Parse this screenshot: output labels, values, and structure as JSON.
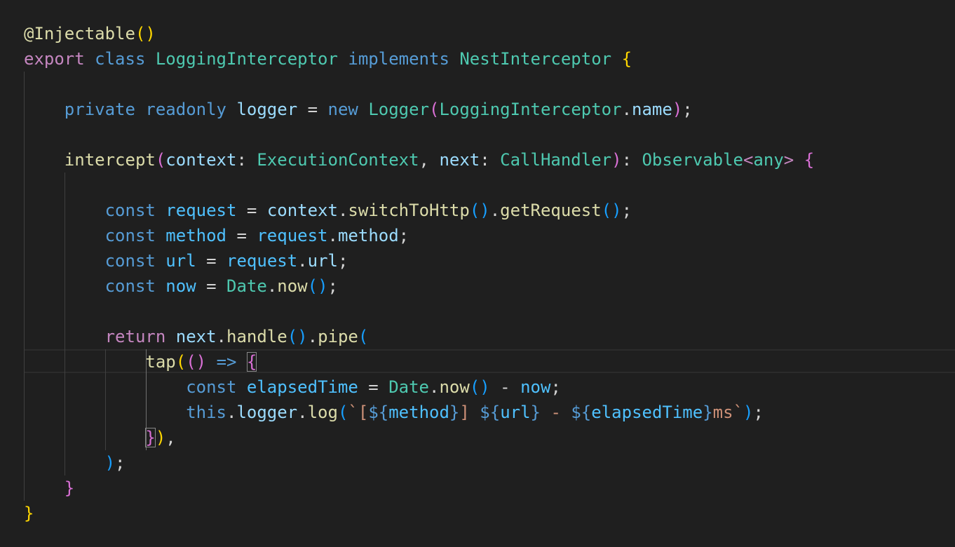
{
  "theme": {
    "background": "#1f1f1f",
    "colors": {
      "keyword": "#569cd6",
      "control": "#c586c0",
      "type": "#4ec9b0",
      "function": "#dcdcaa",
      "variable": "#9cdcfe",
      "constant": "#4fc1ff",
      "string": "#ce9178",
      "plain": "#d4d4d4",
      "bracket1": "#ffd700",
      "bracket2": "#da70d6",
      "bracket3": "#179fff",
      "guide": "#404040",
      "guideActive": "#707070"
    }
  },
  "code": {
    "lines": [
      [
        [
          "@",
          "function"
        ],
        [
          "Injectable",
          "function"
        ],
        [
          "()",
          "bracket1"
        ]
      ],
      [
        [
          "export",
          "control"
        ],
        [
          " ",
          "plain"
        ],
        [
          "class",
          "keyword"
        ],
        [
          " ",
          "plain"
        ],
        [
          "LoggingInterceptor",
          "type"
        ],
        [
          " ",
          "plain"
        ],
        [
          "implements",
          "keyword"
        ],
        [
          " ",
          "plain"
        ],
        [
          "NestInterceptor",
          "type"
        ],
        [
          " ",
          "plain"
        ],
        [
          "{",
          "bracket1"
        ]
      ],
      [],
      [
        [
          "    ",
          "plain"
        ],
        [
          "private",
          "keyword"
        ],
        [
          " ",
          "plain"
        ],
        [
          "readonly",
          "keyword"
        ],
        [
          " ",
          "plain"
        ],
        [
          "logger",
          "variable"
        ],
        [
          " = ",
          "plain"
        ],
        [
          "new",
          "keyword"
        ],
        [
          " ",
          "plain"
        ],
        [
          "Logger",
          "type"
        ],
        [
          "(",
          "bracket2"
        ],
        [
          "LoggingInterceptor",
          "type"
        ],
        [
          ".",
          "plain"
        ],
        [
          "name",
          "variable"
        ],
        [
          ")",
          "bracket2"
        ],
        [
          ";",
          "plain"
        ]
      ],
      [],
      [
        [
          "    ",
          "plain"
        ],
        [
          "intercept",
          "function"
        ],
        [
          "(",
          "bracket2"
        ],
        [
          "context",
          "variable"
        ],
        [
          ": ",
          "plain"
        ],
        [
          "ExecutionContext",
          "type"
        ],
        [
          ", ",
          "plain"
        ],
        [
          "next",
          "variable"
        ],
        [
          ": ",
          "plain"
        ],
        [
          "CallHandler",
          "type"
        ],
        [
          ")",
          "bracket2"
        ],
        [
          ": ",
          "plain"
        ],
        [
          "Observable",
          "type"
        ],
        [
          "<",
          "control"
        ],
        [
          "any",
          "type"
        ],
        [
          "> ",
          "control"
        ],
        [
          "{",
          "bracket2"
        ]
      ],
      [],
      [
        [
          "        ",
          "plain"
        ],
        [
          "const",
          "keyword"
        ],
        [
          " ",
          "plain"
        ],
        [
          "request",
          "constant"
        ],
        [
          " = ",
          "plain"
        ],
        [
          "context",
          "variable"
        ],
        [
          ".",
          "plain"
        ],
        [
          "switchToHttp",
          "function"
        ],
        [
          "()",
          "bracket3"
        ],
        [
          ".",
          "plain"
        ],
        [
          "getRequest",
          "function"
        ],
        [
          "()",
          "bracket3"
        ],
        [
          ";",
          "plain"
        ]
      ],
      [
        [
          "        ",
          "plain"
        ],
        [
          "const",
          "keyword"
        ],
        [
          " ",
          "plain"
        ],
        [
          "method",
          "constant"
        ],
        [
          " = ",
          "plain"
        ],
        [
          "request",
          "constant"
        ],
        [
          ".",
          "plain"
        ],
        [
          "method",
          "variable"
        ],
        [
          ";",
          "plain"
        ]
      ],
      [
        [
          "        ",
          "plain"
        ],
        [
          "const",
          "keyword"
        ],
        [
          " ",
          "plain"
        ],
        [
          "url",
          "constant"
        ],
        [
          " = ",
          "plain"
        ],
        [
          "request",
          "constant"
        ],
        [
          ".",
          "plain"
        ],
        [
          "url",
          "variable"
        ],
        [
          ";",
          "plain"
        ]
      ],
      [
        [
          "        ",
          "plain"
        ],
        [
          "const",
          "keyword"
        ],
        [
          " ",
          "plain"
        ],
        [
          "now",
          "constant"
        ],
        [
          " = ",
          "plain"
        ],
        [
          "Date",
          "type"
        ],
        [
          ".",
          "plain"
        ],
        [
          "now",
          "function"
        ],
        [
          "()",
          "bracket3"
        ],
        [
          ";",
          "plain"
        ]
      ],
      [],
      [
        [
          "        ",
          "plain"
        ],
        [
          "return",
          "control"
        ],
        [
          " ",
          "plain"
        ],
        [
          "next",
          "variable"
        ],
        [
          ".",
          "plain"
        ],
        [
          "handle",
          "function"
        ],
        [
          "()",
          "bracket3"
        ],
        [
          ".",
          "plain"
        ],
        [
          "pipe",
          "function"
        ],
        [
          "(",
          "bracket3"
        ]
      ],
      [
        [
          "            ",
          "plain"
        ],
        [
          "tap",
          "function"
        ],
        [
          "(",
          "bracket1"
        ],
        [
          "()",
          "bracket2"
        ],
        [
          " ",
          "plain"
        ],
        [
          "=>",
          "keyword"
        ],
        [
          " ",
          "plain"
        ],
        [
          "{",
          "bracket2",
          "bm"
        ]
      ],
      [
        [
          "                ",
          "plain"
        ],
        [
          "const",
          "keyword"
        ],
        [
          " ",
          "plain"
        ],
        [
          "elapsedTime",
          "constant"
        ],
        [
          " = ",
          "plain"
        ],
        [
          "Date",
          "type"
        ],
        [
          ".",
          "plain"
        ],
        [
          "now",
          "function"
        ],
        [
          "()",
          "bracket3"
        ],
        [
          " - ",
          "plain"
        ],
        [
          "now",
          "constant"
        ],
        [
          ";",
          "plain"
        ]
      ],
      [
        [
          "                ",
          "plain"
        ],
        [
          "this",
          "keyword"
        ],
        [
          ".",
          "plain"
        ],
        [
          "logger",
          "variable"
        ],
        [
          ".",
          "plain"
        ],
        [
          "log",
          "function"
        ],
        [
          "(",
          "bracket3"
        ],
        [
          "`[",
          "string"
        ],
        [
          "${",
          "keyword"
        ],
        [
          "method",
          "constant"
        ],
        [
          "}",
          "keyword"
        ],
        [
          "] ",
          "string"
        ],
        [
          "${",
          "keyword"
        ],
        [
          "url",
          "constant"
        ],
        [
          "}",
          "keyword"
        ],
        [
          " - ",
          "string"
        ],
        [
          "${",
          "keyword"
        ],
        [
          "elapsedTime",
          "constant"
        ],
        [
          "}",
          "keyword"
        ],
        [
          "ms`",
          "string"
        ],
        [
          ")",
          "bracket3"
        ],
        [
          ";",
          "plain"
        ]
      ],
      [
        [
          "            ",
          "plain"
        ],
        [
          "}",
          "bracket2",
          "bm"
        ],
        [
          ")",
          "bracket1"
        ],
        [
          ",",
          "plain"
        ]
      ],
      [
        [
          "        ",
          "plain"
        ],
        [
          ")",
          "bracket3"
        ],
        [
          ";",
          "plain"
        ]
      ],
      [
        [
          "    ",
          "plain"
        ],
        [
          "}",
          "bracket2"
        ]
      ],
      [
        [
          "}",
          "bracket1"
        ]
      ]
    ]
  }
}
